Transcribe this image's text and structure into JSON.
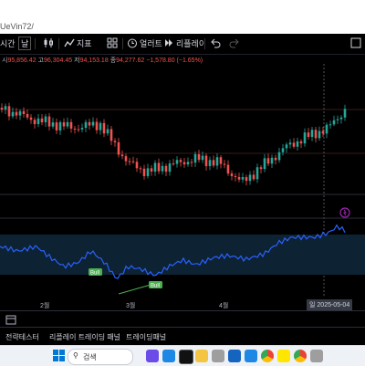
{
  "window": {
    "title": "UeVin72/"
  },
  "toolbar": {
    "timeframe_label": "시간",
    "timeframe_value": "날",
    "indicators_label": "지표",
    "alert_label": "얼러트",
    "replay_label": "리플레이",
    "undo_icon": "undo-icon",
    "redo_icon": "redo-icon"
  },
  "ohlc": {
    "o_key": "시",
    "o_val": "95,856.42",
    "h_key": "고",
    "h_val": "96,304.45",
    "l_key": "저",
    "l_val": "94,153.18",
    "c_key": "종",
    "c_val": "94,277.62",
    "change": "−1,578.80 (−1.65%)"
  },
  "indicator": {
    "signal_labels": [
      "Bull",
      "Bull"
    ]
  },
  "xaxis": {
    "labels": [
      "2월",
      "3월",
      "4월"
    ],
    "current_date": "2025-05-04",
    "current_date_prefix": "일"
  },
  "tabs": [
    "전략테스터",
    "리플레이 트레이딩 패널",
    "트레이딩패널"
  ],
  "taskbar": {
    "search_placeholder": "검색"
  },
  "colors": {
    "bull": "#26a69a",
    "bear": "#ef5350",
    "rsi_line": "#2962ff",
    "rsi_band": "#0d2233",
    "signal_label": "#4caf50",
    "current_price_line": "#f23645"
  }
}
